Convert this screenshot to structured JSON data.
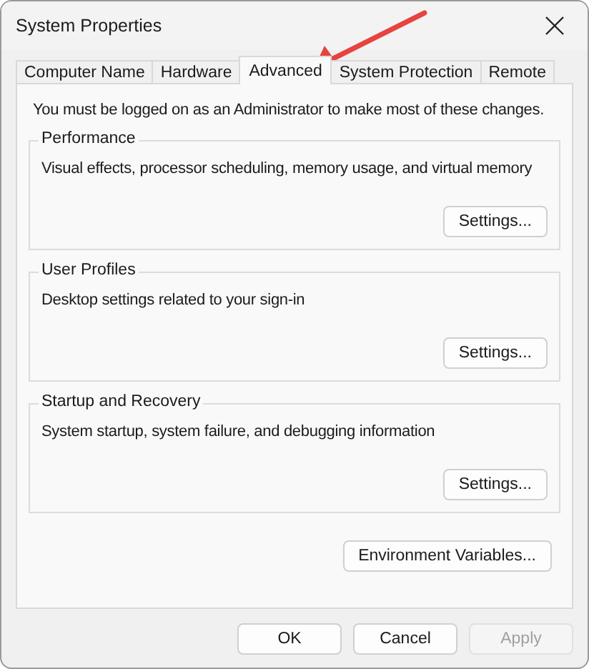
{
  "window": {
    "title": "System Properties"
  },
  "tabs": [
    {
      "label": "Computer Name",
      "selected": false
    },
    {
      "label": "Hardware",
      "selected": false
    },
    {
      "label": "Advanced",
      "selected": true
    },
    {
      "label": "System Protection",
      "selected": false
    },
    {
      "label": "Remote",
      "selected": false
    }
  ],
  "notice": "You must be logged on as an Administrator to make most of these changes.",
  "groups": [
    {
      "title": "Performance",
      "description": "Visual effects, processor scheduling, memory usage, and virtual memory",
      "button": "Settings..."
    },
    {
      "title": "User Profiles",
      "description": "Desktop settings related to your sign-in",
      "button": "Settings..."
    },
    {
      "title": "Startup and Recovery",
      "description": "System startup, system failure, and debugging information",
      "button": "Settings..."
    }
  ],
  "environment_button": "Environment Variables...",
  "buttons": [
    {
      "label": "OK",
      "disabled": false
    },
    {
      "label": "Cancel",
      "disabled": false
    },
    {
      "label": "Apply",
      "disabled": true
    }
  ]
}
